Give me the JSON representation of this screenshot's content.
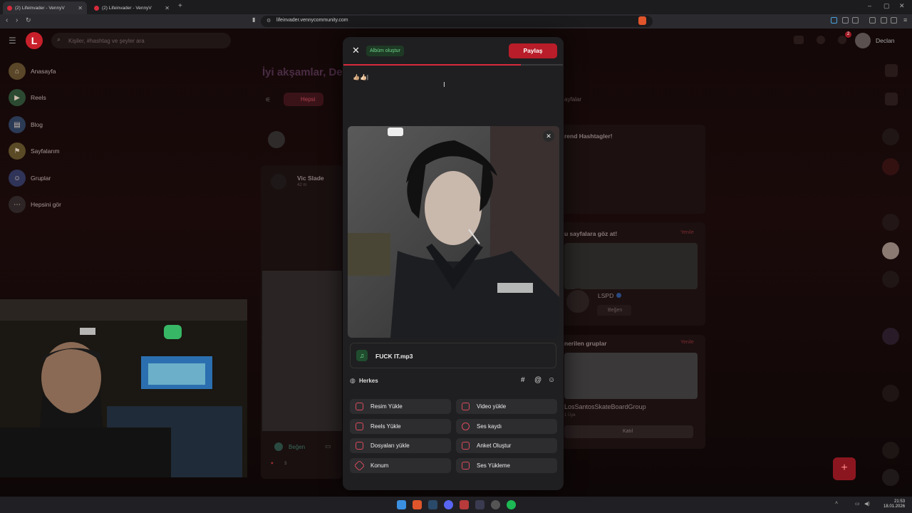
{
  "browser": {
    "tabs": [
      {
        "title": "(2) Lifeinvader - VennyV",
        "active": true
      },
      {
        "title": "(2) Lifeinvader - VennyV",
        "active": false
      }
    ],
    "url": "lifeinvader.vennycommunity.com"
  },
  "header": {
    "logo": "L",
    "search_placeholder": "Kişiler, #hashtag ve şeyler ara",
    "user_name": "Declan",
    "notification_count": "2"
  },
  "sidebar": {
    "items": [
      {
        "label": "Anasayfa",
        "icon": "home-icon"
      },
      {
        "label": "Reels",
        "icon": "reels-icon"
      },
      {
        "label": "Blog",
        "icon": "blog-icon"
      },
      {
        "label": "Sayfalarım",
        "icon": "pages-icon"
      },
      {
        "label": "Gruplar",
        "icon": "groups-icon"
      },
      {
        "label": "Hepsini gör",
        "icon": "more-icon"
      }
    ]
  },
  "feed": {
    "greeting": "İyi akşamlar, De",
    "filter_all": "Hepsi",
    "post_author": "Vic Slade",
    "post_time": "42 m",
    "like_label": "Beğen",
    "like_count": "3",
    "tab_right": "ayfalar"
  },
  "right_panel": {
    "trending_title": "rend Hashtagler!",
    "pages_title": "u sayfalara göz at!",
    "pages_more": "Yenile",
    "page_name": "LSPD",
    "page_like": "Beğen",
    "groups_title": "nerilen gruplar",
    "groups_more": "Yenile",
    "group_name": "LosSantosSkateBoardGroup",
    "group_meta": "1 Üye",
    "group_join": "Katıl"
  },
  "modal": {
    "album_label": "Albüm oluştur",
    "share_label": "Paylaş",
    "progress": 0.81,
    "post_text": "👍🏼👍🏻|",
    "audio_file": "FUCK IT.mp3",
    "privacy": "Herkes",
    "actions": [
      {
        "label": "Resim Yükle",
        "icon": "image-icon"
      },
      {
        "label": "Video yükle",
        "icon": "video-icon"
      },
      {
        "label": "Reels Yükle",
        "icon": "reels-icon"
      },
      {
        "label": "Ses kaydı",
        "icon": "microphone-icon"
      },
      {
        "label": "Dosyaları yükle",
        "icon": "file-icon"
      },
      {
        "label": "Anket Oluştur",
        "icon": "poll-icon"
      },
      {
        "label": "Konum",
        "icon": "location-icon"
      },
      {
        "label": "Ses Yükleme",
        "icon": "music-icon"
      }
    ]
  },
  "taskbar": {
    "time": "21:53",
    "date": "18.01.2026"
  },
  "colors": {
    "accent": "#d62b3b",
    "share_button": "#b81d29",
    "album_badge_text": "#6fd48a"
  }
}
